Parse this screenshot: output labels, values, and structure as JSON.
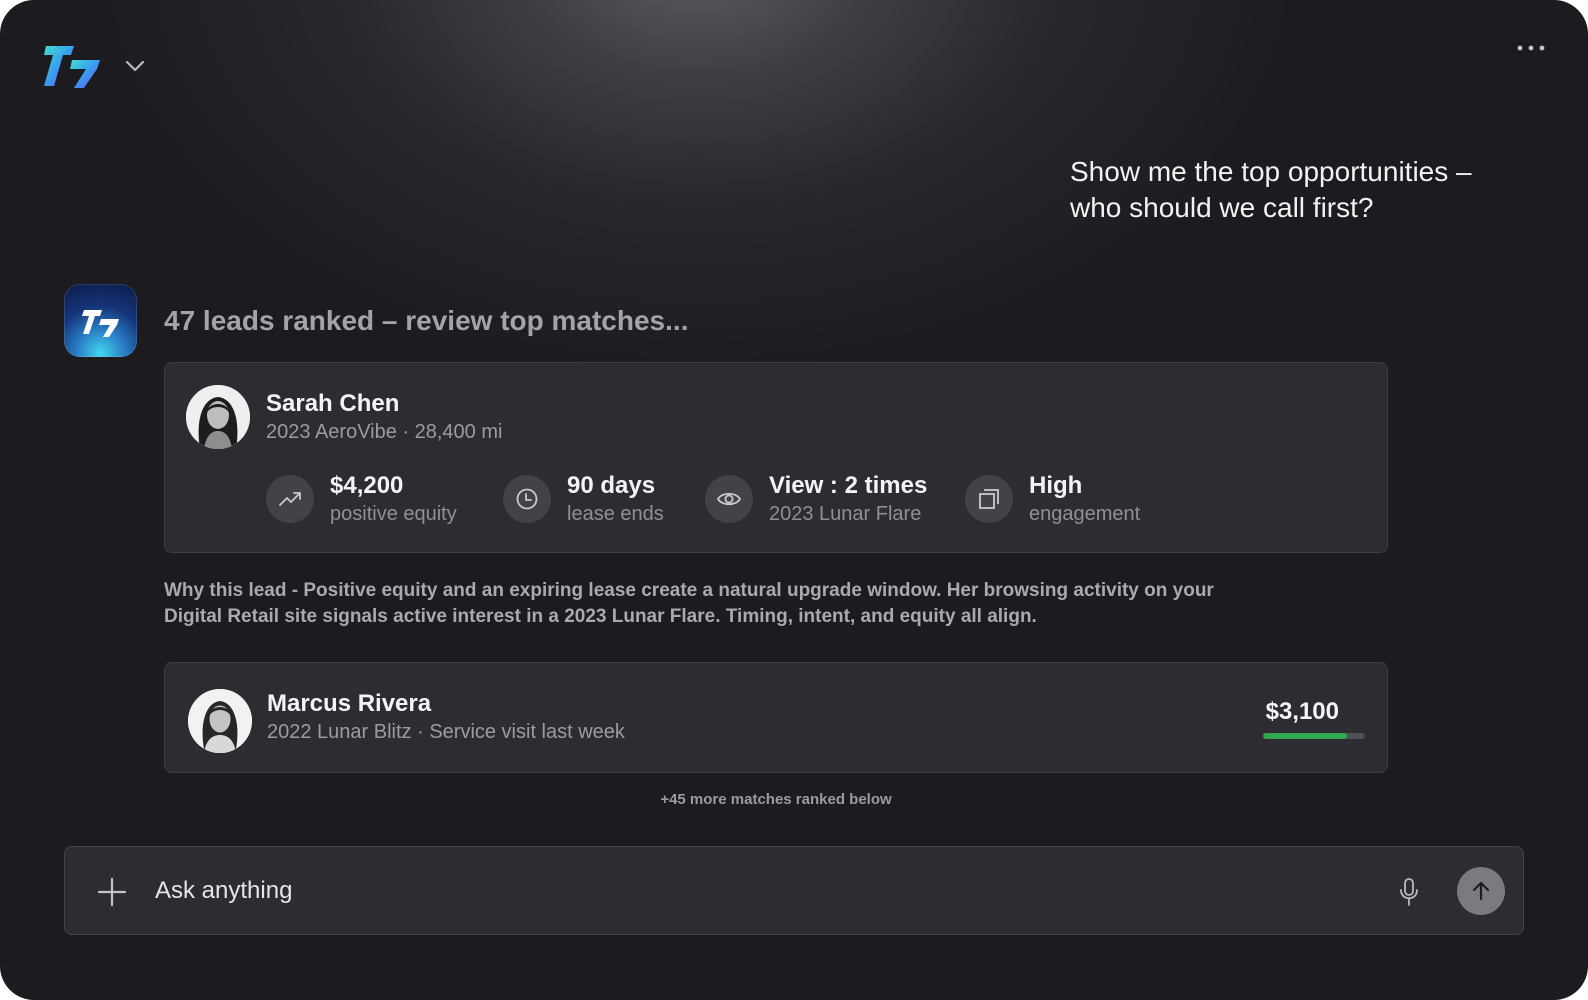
{
  "header": {
    "logo_icon": "brand-logo-icon",
    "menu_icon": "chevron-down-icon",
    "more_icon": "more-horizontal-icon"
  },
  "conversation": {
    "user_message": "Show me the top opportunities – who should we call first?",
    "assistant_heading": "47 leads ranked – review top matches...",
    "leads": [
      {
        "name": "Sarah Chen",
        "subtitle": "2023 AeroVibe · 28,400 mi",
        "metrics": [
          {
            "icon": "trending-up-icon",
            "value": "$4,200",
            "label": "positive equity"
          },
          {
            "icon": "clock-icon",
            "value": "90 days",
            "label": "lease ends"
          },
          {
            "icon": "eye-icon",
            "value": "View : 2 times",
            "label": "2023 Lunar Flare"
          },
          {
            "icon": "copy-icon",
            "value": "High",
            "label": "engagement"
          }
        ],
        "why": "Why this lead - Positive equity and an expiring lease create a natural upgrade window. Her browsing activity on your Digital Retail site signals active interest in a 2023 Lunar Flare. Timing, intent, and equity all align."
      },
      {
        "name": "Marcus Rivera",
        "subtitle": "2022 Lunar Blitz · Service visit last week",
        "equity": "$3,100",
        "equity_fraction": 0.82
      }
    ],
    "more_matches": "+45 more matches ranked below"
  },
  "composer": {
    "placeholder": "Ask anything",
    "add_icon": "plus-icon",
    "mic_icon": "microphone-icon",
    "send_icon": "arrow-up-icon"
  },
  "colors": {
    "background": "#1c1c20",
    "card": "#2c2c32",
    "accent_green": "#2fa84f",
    "brand_cyan": "#3fd3e8",
    "brand_violet": "#6b4ef0"
  }
}
